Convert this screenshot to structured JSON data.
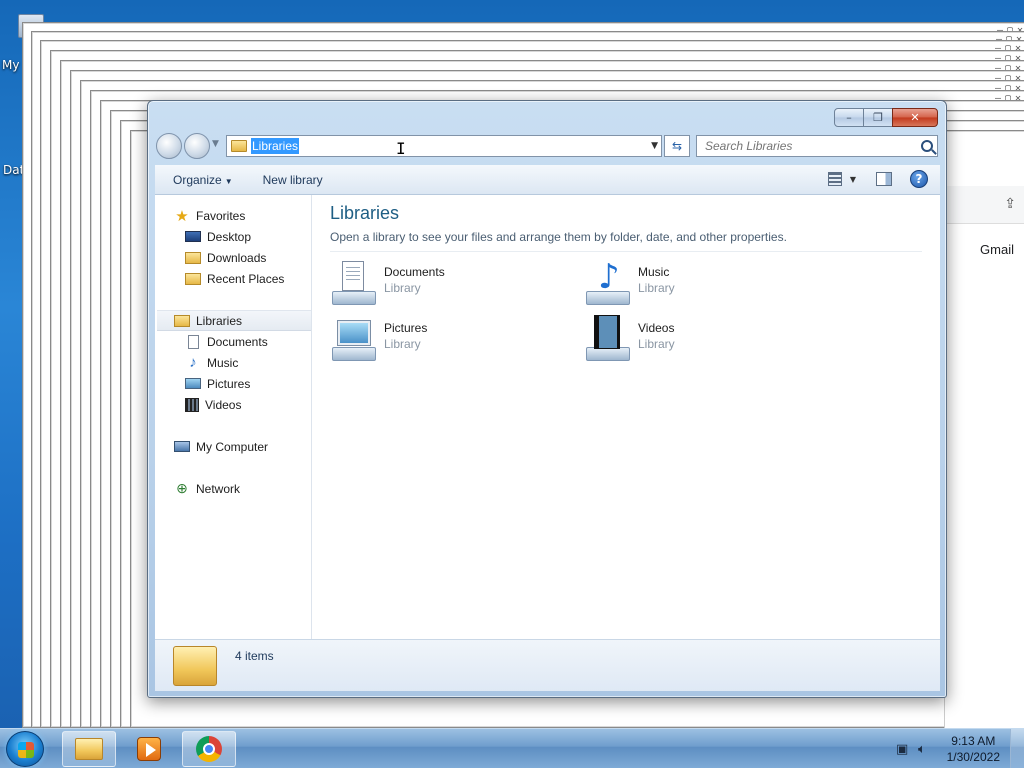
{
  "desktop": {
    "icon_labels": [
      "My",
      "Dat"
    ]
  },
  "background_browser": {
    "gmail_link": "Gmail"
  },
  "explorer": {
    "address": {
      "value": "Libraries"
    },
    "search": {
      "placeholder": "Search Libraries"
    },
    "toolbar": {
      "organize": "Organize",
      "new_library": "New library"
    },
    "nav": {
      "favorites": "Favorites",
      "favorites_items": [
        "Desktop",
        "Downloads",
        "Recent Places"
      ],
      "libraries": "Libraries",
      "libraries_items": [
        "Documents",
        "Music",
        "Pictures",
        "Videos"
      ],
      "computer": "My Computer",
      "network": "Network"
    },
    "content": {
      "title": "Libraries",
      "description": "Open a library to see your files and arrange them by folder, date, and other properties.",
      "items": [
        {
          "name": "Documents",
          "type": "Library",
          "icon": "documents-library-icon"
        },
        {
          "name": "Music",
          "type": "Library",
          "icon": "music-library-icon"
        },
        {
          "name": "Pictures",
          "type": "Library",
          "icon": "pictures-library-icon"
        },
        {
          "name": "Videos",
          "type": "Library",
          "icon": "videos-library-icon"
        }
      ]
    },
    "details": {
      "count": "4 items"
    }
  },
  "taskbar": {
    "time": "9:13 AM",
    "date": "1/30/2022"
  },
  "colors": {
    "accent": "#1e5e84",
    "selection": "#3399ff",
    "desktop": "#1d6fc4"
  }
}
